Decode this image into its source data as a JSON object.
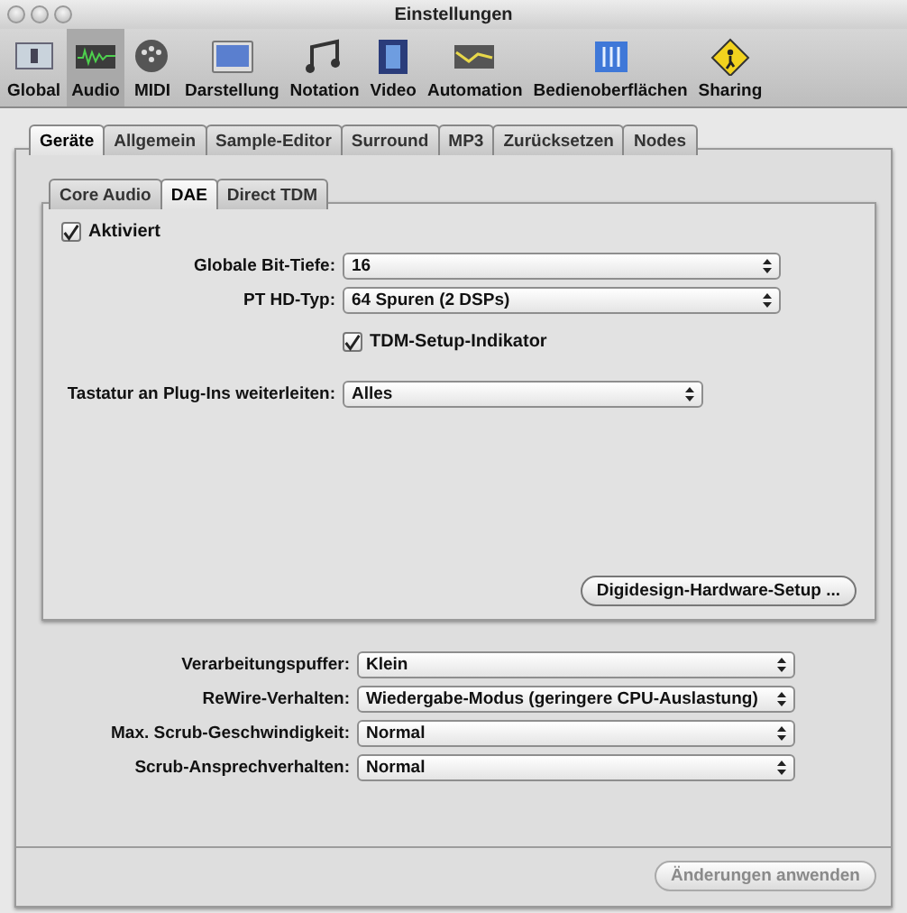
{
  "window": {
    "title": "Einstellungen"
  },
  "toolbar": [
    {
      "label": "Global",
      "selected": false
    },
    {
      "label": "Audio",
      "selected": true
    },
    {
      "label": "MIDI",
      "selected": false
    },
    {
      "label": "Darstellung",
      "selected": false
    },
    {
      "label": "Notation",
      "selected": false
    },
    {
      "label": "Video",
      "selected": false
    },
    {
      "label": "Automation",
      "selected": false
    },
    {
      "label": "Bedienoberflächen",
      "selected": false
    },
    {
      "label": "Sharing",
      "selected": false
    }
  ],
  "tabs": [
    {
      "label": "Geräte",
      "selected": true
    },
    {
      "label": "Allgemein",
      "selected": false
    },
    {
      "label": "Sample-Editor",
      "selected": false
    },
    {
      "label": "Surround",
      "selected": false
    },
    {
      "label": "MP3",
      "selected": false
    },
    {
      "label": "Zurücksetzen",
      "selected": false
    },
    {
      "label": "Nodes",
      "selected": false
    }
  ],
  "subtabs": [
    {
      "label": "Core Audio",
      "selected": false
    },
    {
      "label": "DAE",
      "selected": true
    },
    {
      "label": "Direct TDM",
      "selected": false
    }
  ],
  "enabled": {
    "label": "Aktiviert",
    "checked": true
  },
  "dae_settings": [
    {
      "kind": "select",
      "label": "Globale Bit-Tiefe:",
      "value": "16"
    },
    {
      "kind": "select",
      "label": "PT HD-Typ:",
      "value": "64 Spuren (2 DSPs)"
    },
    {
      "kind": "checkbox",
      "label": "TDM-Setup-Indikator",
      "checked": true
    },
    {
      "kind": "narrowselect",
      "label": "Tastatur an Plug-Ins weiterleiten:",
      "value": "Alles"
    }
  ],
  "hardware_button": {
    "label": "Digidesign-Hardware-Setup ..."
  },
  "settings": [
    {
      "label": "Verarbeitungspuffer:",
      "value": "Klein"
    },
    {
      "label": "ReWire-Verhalten:",
      "value": "Wiedergabe-Modus (geringere CPU-Auslastung)"
    },
    {
      "label": "Max. Scrub-Geschwindigkeit:",
      "value": "Normal"
    },
    {
      "label": "Scrub-Ansprechverhalten:",
      "value": "Normal"
    }
  ],
  "apply_button": {
    "label": "Änderungen anwenden",
    "disabled": true
  }
}
